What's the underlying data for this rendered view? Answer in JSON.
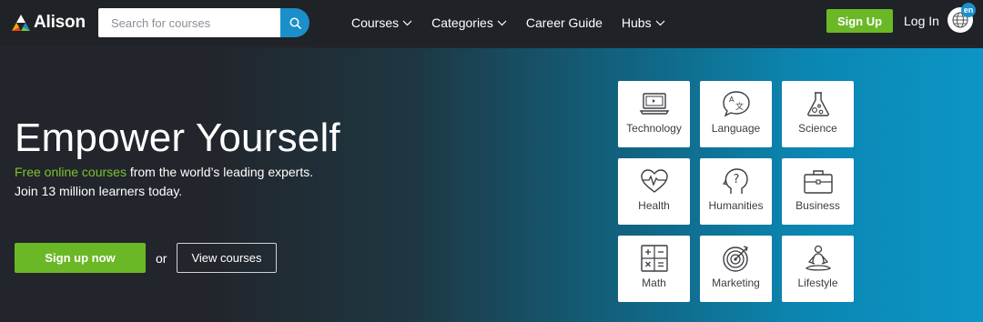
{
  "brand": {
    "name": "Alison",
    "colors": {
      "accent_green": "#6bb826",
      "accent_blue": "#1a8fc9"
    }
  },
  "search": {
    "placeholder": "Search for courses",
    "icon": "search-icon"
  },
  "nav": {
    "menu": [
      {
        "label": "Courses",
        "dropdown": true
      },
      {
        "label": "Categories",
        "dropdown": true
      },
      {
        "label": "Career Guide",
        "dropdown": false
      },
      {
        "label": "Hubs",
        "dropdown": true
      }
    ],
    "signup_label": "Sign Up",
    "login_label": "Log In",
    "language_badge": "en"
  },
  "hero": {
    "title": "Empower Yourself",
    "highlight": "Free online courses",
    "line1_rest": " from the world’s leading experts.",
    "line2": "Join 13 million learners today.",
    "signup_button": "Sign up now",
    "or_text": "or",
    "view_button": "View courses"
  },
  "categories": [
    {
      "label": "Technology",
      "icon": "laptop-icon"
    },
    {
      "label": "Language",
      "icon": "translate-icon"
    },
    {
      "label": "Science",
      "icon": "flask-icon"
    },
    {
      "label": "Health",
      "icon": "heartbeat-icon"
    },
    {
      "label": "Humanities",
      "icon": "head-question-icon"
    },
    {
      "label": "Business",
      "icon": "briefcase-icon"
    },
    {
      "label": "Math",
      "icon": "calculator-icon"
    },
    {
      "label": "Marketing",
      "icon": "target-icon"
    },
    {
      "label": "Lifestyle",
      "icon": "meditation-icon"
    }
  ]
}
